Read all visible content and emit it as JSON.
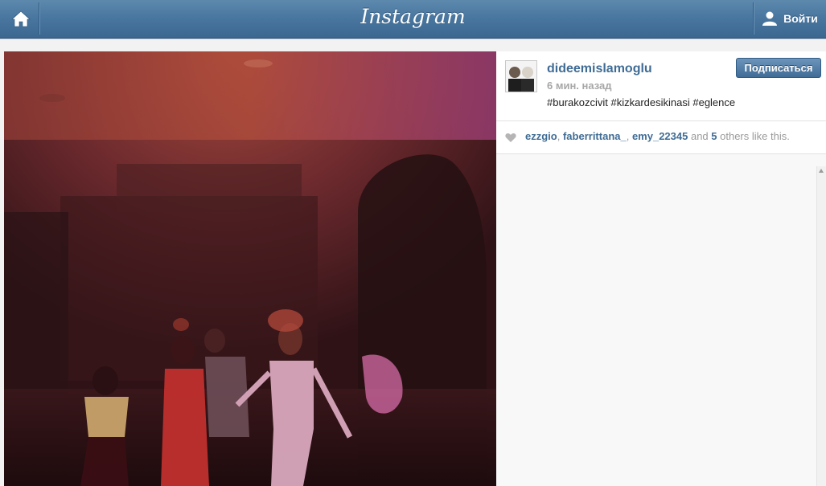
{
  "header": {
    "logo": "Instagram",
    "login_label": "Войти"
  },
  "post": {
    "username": "dideemislamoglu",
    "timestamp": "6 мин. назад",
    "caption": "#burakozcivit #kizkardesikinasi #eglence",
    "follow_label": "Подписаться"
  },
  "likes": {
    "user1": "ezzgio",
    "sep1": ", ",
    "user2": "faberrittana_",
    "sep2": ", ",
    "user3": "emy_22345",
    "and_text": " and ",
    "others_count": "5",
    "others_text": " others like this."
  },
  "icons": {
    "home": "home-icon",
    "user": "user-icon",
    "heart": "heart-icon"
  },
  "colors": {
    "topbar": "#4a77a0",
    "link": "#3f6c95",
    "follow_button": "#4f7ca6"
  }
}
